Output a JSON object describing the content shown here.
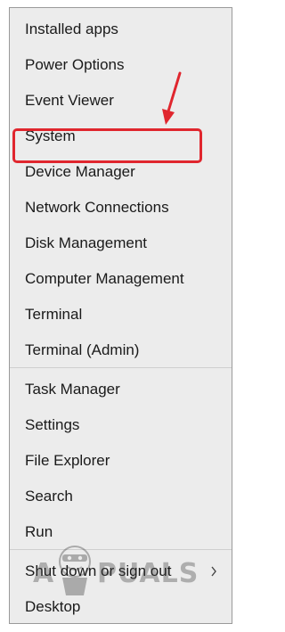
{
  "menu": {
    "items": [
      {
        "label": "Installed apps"
      },
      {
        "label": "Power Options"
      },
      {
        "label": "Event Viewer"
      },
      {
        "label": "System"
      },
      {
        "label": "Device Manager"
      },
      {
        "label": "Network Connections"
      },
      {
        "label": "Disk Management"
      },
      {
        "label": "Computer Management"
      },
      {
        "label": "Terminal"
      },
      {
        "label": "Terminal (Admin)"
      },
      {
        "label": "Task Manager"
      },
      {
        "label": "Settings"
      },
      {
        "label": "File Explorer"
      },
      {
        "label": "Search"
      },
      {
        "label": "Run"
      },
      {
        "label": "Shut down or sign out",
        "submenu_icon": "chevron-right-icon"
      },
      {
        "label": "Desktop"
      }
    ],
    "highlighted_item": "Device Manager",
    "highlight_color": "#e0262e"
  },
  "watermark": {
    "text_left": "A",
    "text_right": "PUALS"
  },
  "colors": {
    "menu_background": "#ececec",
    "text": "#1a1a1a",
    "separator": "#cfcfcf",
    "annotation": "#e0262e"
  }
}
